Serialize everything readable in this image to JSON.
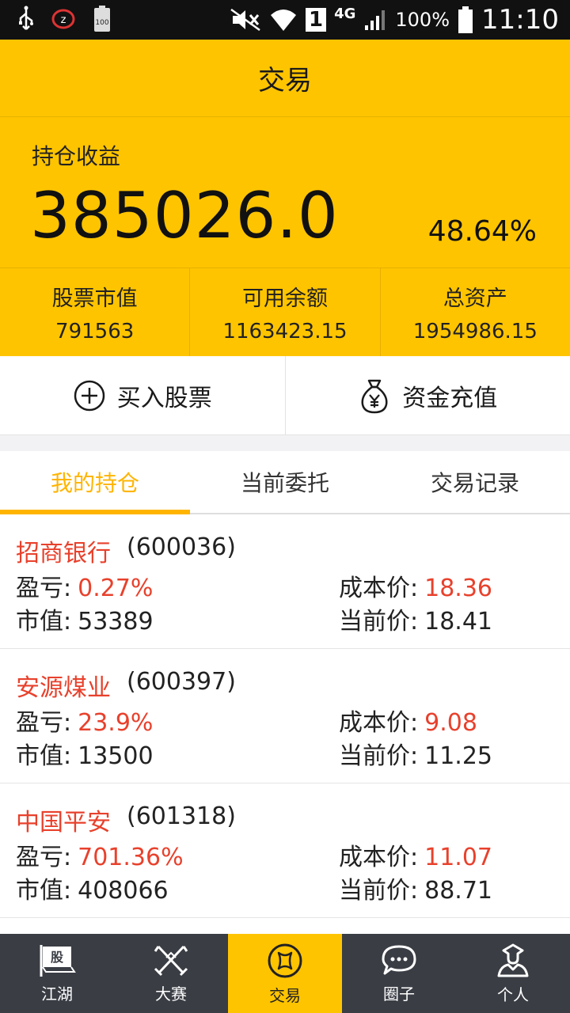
{
  "status_bar": {
    "battery_percent": "100%",
    "network": "4G",
    "sim": "1",
    "time": "11:10",
    "battery_icon_text": "100"
  },
  "header": {
    "title": "交易"
  },
  "summary": {
    "label": "持仓收益",
    "value": "385026.0",
    "percent": "48.64%",
    "stats": [
      {
        "label": "股票市值",
        "value": "791563"
      },
      {
        "label": "可用余额",
        "value": "1163423.15"
      },
      {
        "label": "总资产",
        "value": "1954986.15"
      }
    ]
  },
  "actions": [
    {
      "label": "买入股票",
      "icon": "plus-circle-icon"
    },
    {
      "label": "资金充值",
      "icon": "money-bag-icon"
    }
  ],
  "tabs": [
    {
      "label": "我的持仓",
      "active": true
    },
    {
      "label": "当前委托",
      "active": false
    },
    {
      "label": "交易记录",
      "active": false
    }
  ],
  "labels": {
    "profit": "盈亏:",
    "market_value": "市值:",
    "cost_price": "成本价:",
    "current_price": "当前价:"
  },
  "holdings": [
    {
      "name": "招商银行",
      "code": "(600036)",
      "profit": "0.27%",
      "market_value": "53389",
      "cost_price": "18.36",
      "current_price": "18.41"
    },
    {
      "name": "安源煤业",
      "code": "(600397)",
      "profit": "23.9%",
      "market_value": "13500",
      "cost_price": "9.08",
      "current_price": "11.25"
    },
    {
      "name": "中国平安",
      "code": "(601318)",
      "profit": "701.36%",
      "market_value": "408066",
      "cost_price": "11.07",
      "current_price": "88.71"
    }
  ],
  "bottom_nav": [
    {
      "label": "江湖",
      "icon": "flag-icon",
      "active": false,
      "icon_text": "股"
    },
    {
      "label": "大赛",
      "icon": "crossed-swords-icon",
      "active": false
    },
    {
      "label": "交易",
      "icon": "trade-icon",
      "active": true
    },
    {
      "label": "圈子",
      "icon": "chat-bubble-icon",
      "active": false
    },
    {
      "label": "个人",
      "icon": "person-icon",
      "active": false
    }
  ],
  "colors": {
    "brand": "#ffc400",
    "accent_tab": "#ffb400",
    "loss_gain_red": "#e8412c",
    "nav_bg": "#3a3d44"
  }
}
